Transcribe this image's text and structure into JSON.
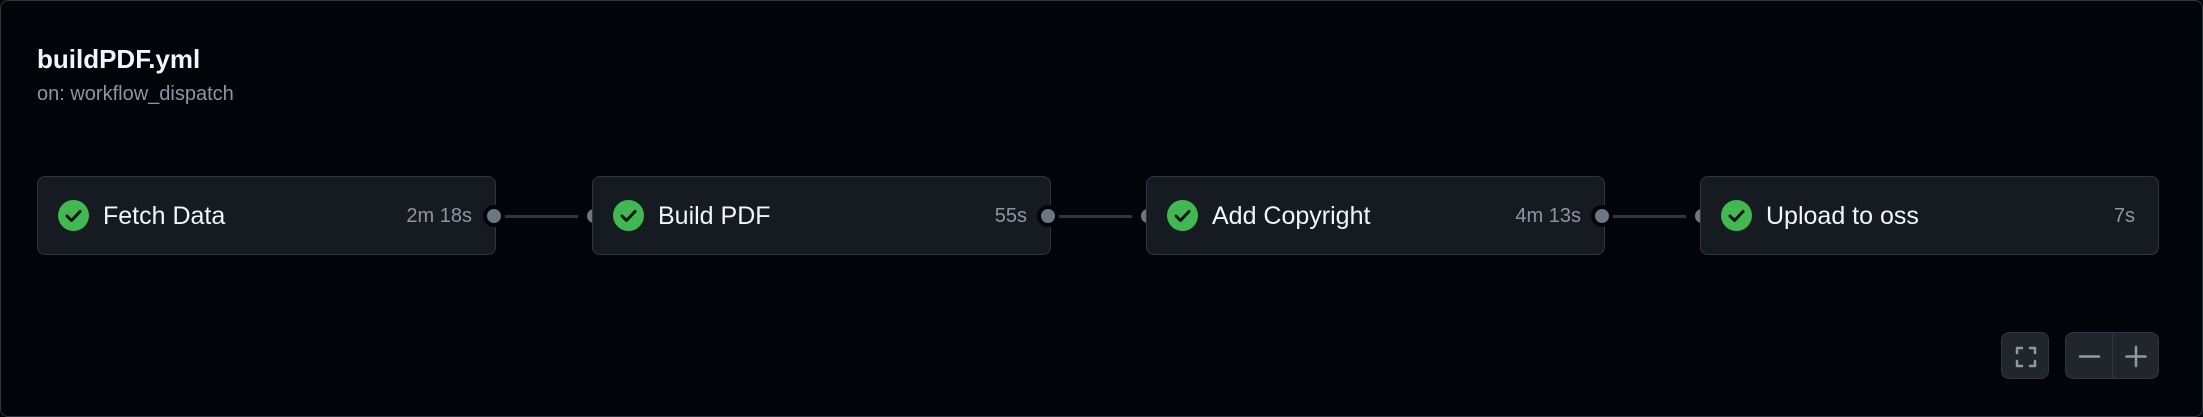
{
  "workflow": {
    "title": "buildPDF.yml",
    "trigger": "on: workflow_dispatch"
  },
  "jobs": [
    {
      "name": "Fetch Data",
      "duration": "2m 18s",
      "status": "success",
      "icon": "check-circle-icon"
    },
    {
      "name": "Build PDF",
      "duration": "55s",
      "status": "success",
      "icon": "check-circle-icon"
    },
    {
      "name": "Add Copyright",
      "duration": "4m 13s",
      "status": "success",
      "icon": "check-circle-icon"
    },
    {
      "name": "Upload to oss",
      "duration": "7s",
      "status": "success",
      "icon": "check-circle-icon"
    }
  ],
  "controls": {
    "fullscreen_icon": "fullscreen-icon",
    "zoom_out_icon": "minus-icon",
    "zoom_in_icon": "plus-icon"
  },
  "colors": {
    "background": "#010409",
    "card": "#161b22",
    "border": "#30363d",
    "success": "#3fb950",
    "text_muted": "#8d96a0"
  }
}
